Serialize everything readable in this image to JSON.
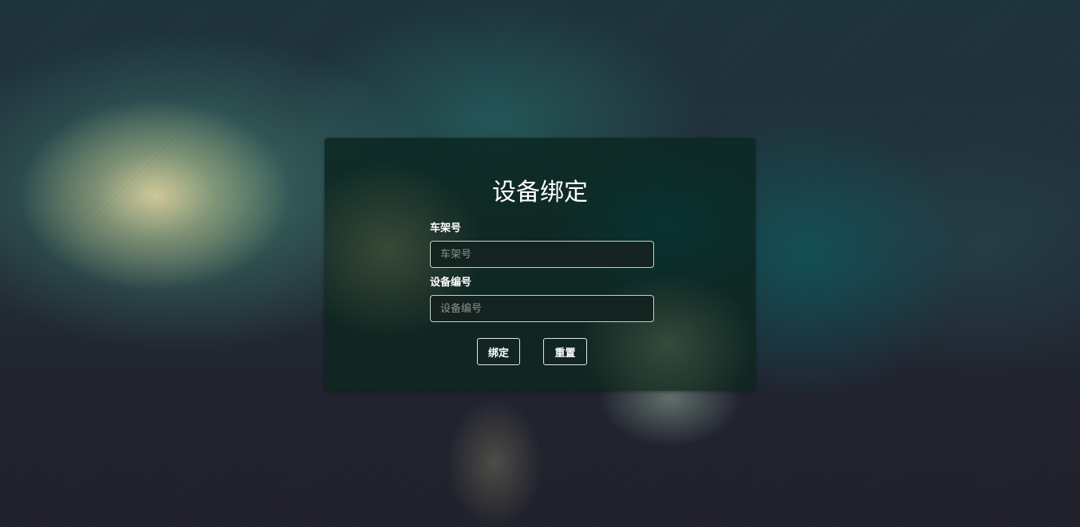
{
  "form": {
    "title": "设备绑定",
    "frame_number": {
      "label": "车架号",
      "value": "",
      "placeholder": "车架号"
    },
    "device_number": {
      "label": "设备编号",
      "value": "",
      "placeholder": "设备编号"
    },
    "bind_label": "绑定",
    "reset_label": "重置"
  },
  "colors": {
    "background": "#222431",
    "panel": "#10261f",
    "text": "#ffffff",
    "input_border": "#c9cfcc"
  }
}
